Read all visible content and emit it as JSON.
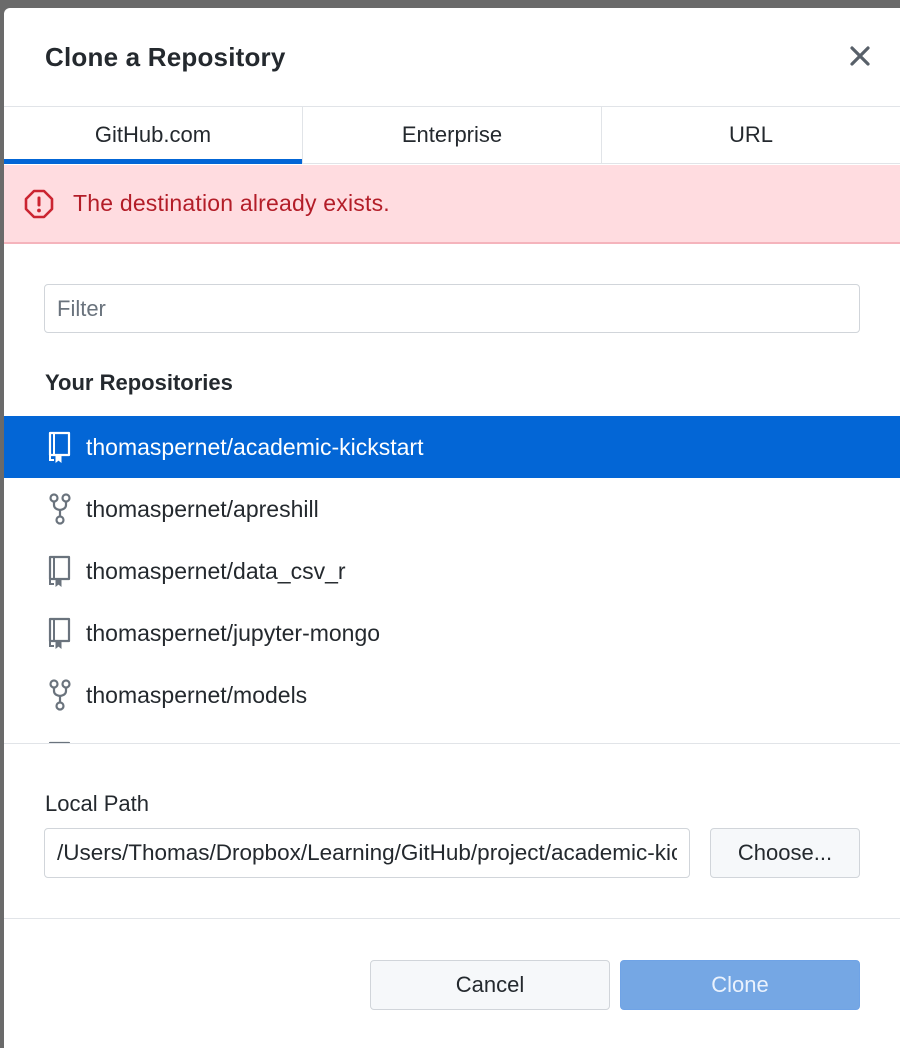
{
  "dialog": {
    "title": "Clone a Repository"
  },
  "tabs": [
    {
      "label": "GitHub.com",
      "selected": true
    },
    {
      "label": "Enterprise",
      "selected": false
    },
    {
      "label": "URL",
      "selected": false
    }
  ],
  "error": {
    "message": "The destination already exists."
  },
  "filter": {
    "placeholder": "Filter",
    "value": ""
  },
  "repositories": {
    "section_label": "Your Repositories",
    "items": [
      {
        "name": "thomaspernet/academic-kickstart",
        "icon": "repo-icon",
        "selected": true
      },
      {
        "name": "thomaspernet/apreshill",
        "icon": "fork-icon",
        "selected": false
      },
      {
        "name": "thomaspernet/data_csv_r",
        "icon": "repo-icon",
        "selected": false
      },
      {
        "name": "thomaspernet/jupyter-mongo",
        "icon": "repo-icon",
        "selected": false
      },
      {
        "name": "thomaspernet/models",
        "icon": "fork-icon",
        "selected": false
      }
    ]
  },
  "local_path": {
    "label": "Local Path",
    "value": "/Users/Thomas/Dropbox/Learning/GitHub/project/academic-kickstart",
    "choose_label": "Choose..."
  },
  "footer": {
    "cancel_label": "Cancel",
    "clone_label": "Clone"
  },
  "colors": {
    "accent": "#0366d6",
    "error_bg": "#ffdce0",
    "error_text": "#b31d28",
    "clone_disabled": "#75a7e4"
  }
}
